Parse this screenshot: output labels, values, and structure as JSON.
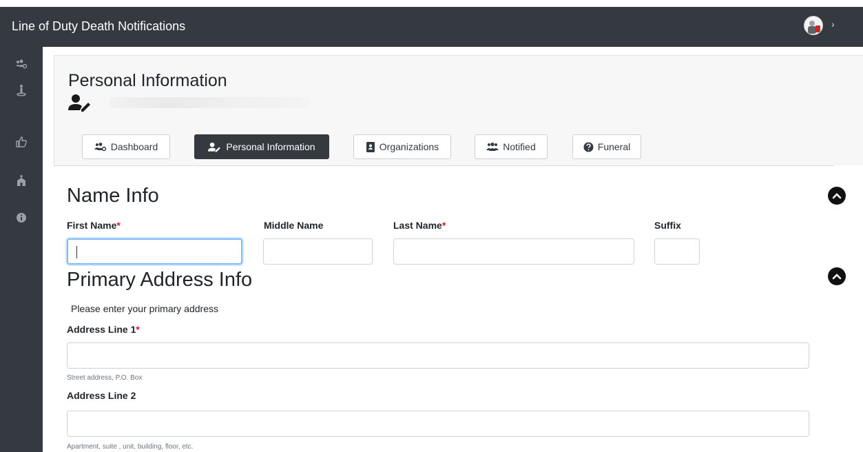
{
  "app": {
    "title": "Line of Duty Death Notifications"
  },
  "header": {
    "avatar_icon": "user-avatar-icon",
    "menu_chevron": "›"
  },
  "sidebar": {
    "items": [
      {
        "icon": "users-cog-icon"
      },
      {
        "icon": "person-icon"
      },
      {
        "icon": "thumbs-up-icon"
      },
      {
        "icon": "church-icon"
      },
      {
        "icon": "info-circle-icon"
      }
    ]
  },
  "page": {
    "title": "Personal Information",
    "title_icon": "user-edit-icon"
  },
  "tabs": [
    {
      "label": "Dashboard",
      "icon": "users-cog-icon",
      "active": false
    },
    {
      "label": "Personal Information",
      "icon": "user-edit-icon",
      "active": true
    },
    {
      "label": "Organizations",
      "icon": "address-book-icon",
      "active": false
    },
    {
      "label": "Notified",
      "icon": "users-icon",
      "active": false
    },
    {
      "label": "Funeral",
      "icon": "question-circle-icon",
      "active": false
    }
  ],
  "name_info": {
    "heading": "Name Info",
    "first_name": {
      "label": "First Name",
      "required_mark": "*",
      "value": ""
    },
    "middle_name": {
      "label": "Middle Name",
      "value": ""
    },
    "last_name": {
      "label": "Last Name",
      "required_mark": "*",
      "value": ""
    },
    "suffix": {
      "label": "Suffix",
      "value": ""
    }
  },
  "address_info": {
    "heading": "Primary Address Info",
    "instructions": "Please enter your primary address",
    "address_line_1": {
      "label": "Address Line 1",
      "required_mark": "*",
      "value": "",
      "help": "Street address, P.O. Box"
    },
    "address_line_2": {
      "label": "Address Line 2",
      "value": "",
      "help": "Apartment, suite , unit, building, floor, etc."
    }
  },
  "colors": {
    "dark": "#343a40",
    "required": "#d9112b",
    "focus": "#80bdff"
  }
}
